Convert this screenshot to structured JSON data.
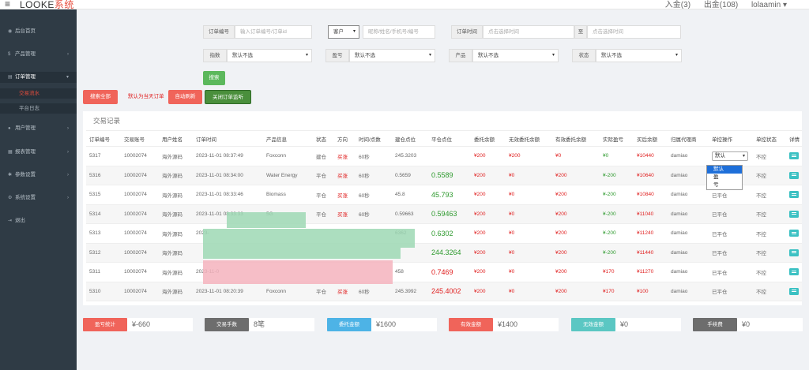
{
  "header": {
    "logo_main": "LOOKE",
    "logo_accent": "系统",
    "right_items": [
      "入金(3)",
      "出金(108)",
      "lolaamin ▾"
    ]
  },
  "sidebar": {
    "items": [
      {
        "label": "后台首页"
      },
      {
        "label": "产品管理"
      },
      {
        "label": "订单管理"
      },
      {
        "label": "用户管理"
      },
      {
        "label": "报表管理"
      },
      {
        "label": "参数设置"
      },
      {
        "label": "系统设置"
      },
      {
        "label": "退出"
      }
    ],
    "sub_items": [
      {
        "label": "交易流水"
      },
      {
        "label": "平台日志"
      }
    ]
  },
  "filters": {
    "order_no_label": "订单编号",
    "order_no_placeholder": "输入订单编号/订单id",
    "customer_select": "客户",
    "customer_placeholder": "昵称/姓名/手机号/编号",
    "time_label": "订单时间",
    "time_start_placeholder": "点击选择时间",
    "time_to": "至",
    "time_end_placeholder": "点击选择时间",
    "index_label": "指数",
    "index_value": "默认不选",
    "pnl_label": "盈亏",
    "pnl_value": "默认不选",
    "product_label": "产品",
    "product_value": "默认不选",
    "status_label": "状态",
    "status_value": "默认不选",
    "search_button": "搜索"
  },
  "actions": {
    "search_all": "搜索全部",
    "default_note": "默认为当天订单",
    "auto_refresh": "自动刷新",
    "close_monitor": "关闭订单监听"
  },
  "panel": {
    "title": "交易记录",
    "columns": [
      "订单编号",
      "交易账号",
      "用户姓名",
      "订单时间",
      "产品信息",
      "状态",
      "方向",
      "时间/点数",
      "建仓点位",
      "平仓点位",
      "委托余额",
      "无效委托余额",
      "有效委托余额",
      "实际盈亏",
      "买后余额",
      "归属代理商",
      "单控操作",
      "单控状态",
      "详情"
    ],
    "rows": [
      {
        "id": "5317",
        "acct": "10002074",
        "name": "海外源码",
        "time": "2023-11-01 08:37:49",
        "product": "Foxconn",
        "status": "建仓",
        "dir": "买涨",
        "dur": "60秒",
        "open": "245.3203",
        "close": "",
        "entrust": "¥200",
        "invalid": "¥200",
        "valid": "¥0",
        "pnl": "¥0",
        "after": "¥10440",
        "agent": "damiao",
        "op": "默认",
        "ctrl": "不控"
      },
      {
        "id": "5316",
        "acct": "10002074",
        "name": "海外源码",
        "time": "2023-11-01 08:34:00",
        "product": "Water Energy",
        "status": "平仓",
        "dir": "买涨",
        "dur": "60秒",
        "open": "0.5659",
        "close": "0.5589",
        "entrust": "¥200",
        "invalid": "¥0",
        "valid": "¥200",
        "pnl": "¥-200",
        "after": "¥10640",
        "agent": "damiao",
        "op": "已平仓",
        "ctrl": "不控"
      },
      {
        "id": "5315",
        "acct": "10002074",
        "name": "海外源码",
        "time": "2023-11-01 08:33:46",
        "product": "Biomass",
        "status": "平仓",
        "dir": "买涨",
        "dur": "60秒",
        "open": "45.8",
        "close": "45.793",
        "entrust": "¥200",
        "invalid": "¥0",
        "valid": "¥200",
        "pnl": "¥-200",
        "after": "¥10840",
        "agent": "damiao",
        "op": "已平仓",
        "ctrl": "不控"
      },
      {
        "id": "5314",
        "acct": "10002074",
        "name": "海外源码",
        "time": "2023-11-01 08:33:33",
        "product": "5G",
        "status": "平仓",
        "dir": "买涨",
        "dur": "60秒",
        "open": "0.59663",
        "close": "0.59463",
        "entrust": "¥200",
        "invalid": "¥0",
        "valid": "¥200",
        "pnl": "¥-200",
        "after": "¥11040",
        "agent": "damiao",
        "op": "已平仓",
        "ctrl": "不控"
      },
      {
        "id": "5313",
        "acct": "10002074",
        "name": "海外源码",
        "time": "2023-",
        "product": "",
        "status": "",
        "dir": "",
        "dur": "",
        "open": "6362",
        "close": "0.6302",
        "entrust": "¥200",
        "invalid": "¥0",
        "valid": "¥200",
        "pnl": "¥-200",
        "after": "¥11240",
        "agent": "damiao",
        "op": "已平仓",
        "ctrl": "不控"
      },
      {
        "id": "5312",
        "acct": "10002074",
        "name": "海外源码",
        "time": "",
        "product": "",
        "status": "",
        "dir": "",
        "dur": "",
        "open": "",
        "close": "244.3264",
        "entrust": "¥200",
        "invalid": "¥0",
        "valid": "¥200",
        "pnl": "¥-200",
        "after": "¥11440",
        "agent": "damiao",
        "op": "已平仓",
        "ctrl": "不控"
      },
      {
        "id": "5311",
        "acct": "10002074",
        "name": "海外源码",
        "time": "2023-11-0",
        "product": "",
        "status": "",
        "dir": "",
        "dur": "",
        "open": "458",
        "close": "0.7469",
        "entrust": "¥200",
        "invalid": "¥0",
        "valid": "¥200",
        "pnl": "¥170",
        "after": "¥11270",
        "agent": "damiao",
        "op": "已平仓",
        "ctrl": "不控"
      },
      {
        "id": "5310",
        "acct": "10002074",
        "name": "海外源码",
        "time": "2023-11-01 08:20:39",
        "product": "Foxconn",
        "status": "平仓",
        "dir": "买涨",
        "dur": "60秒",
        "open": "245.3992",
        "close": "245.4002",
        "entrust": "¥200",
        "invalid": "¥0",
        "valid": "¥200",
        "pnl": "¥170",
        "after": "¥100",
        "agent": "damiao",
        "op": "已平仓",
        "ctrl": "不控"
      }
    ],
    "dropdown_options": [
      "默认",
      "盈",
      "亏"
    ]
  },
  "stats": [
    {
      "label": "盈亏统计",
      "value": "¥-660",
      "color": "#f0645a"
    },
    {
      "label": "交易手数",
      "value": "8笔",
      "color": "#6d6d6d"
    },
    {
      "label": "委托金额",
      "value": "¥1600",
      "color": "#4db3e6"
    },
    {
      "label": "有效金额",
      "value": "¥1400",
      "color": "#f0645a"
    },
    {
      "label": "无效金额",
      "value": "¥0",
      "color": "#5bc7c3"
    },
    {
      "label": "手续费",
      "value": "¥0",
      "color": "#6d6d6d"
    }
  ],
  "colors": {
    "sidebar_bg": "#2f3b45",
    "accent_red": "#f0645a",
    "accent_green": "#5cb85c",
    "dark_green": "#4a8f3c"
  }
}
